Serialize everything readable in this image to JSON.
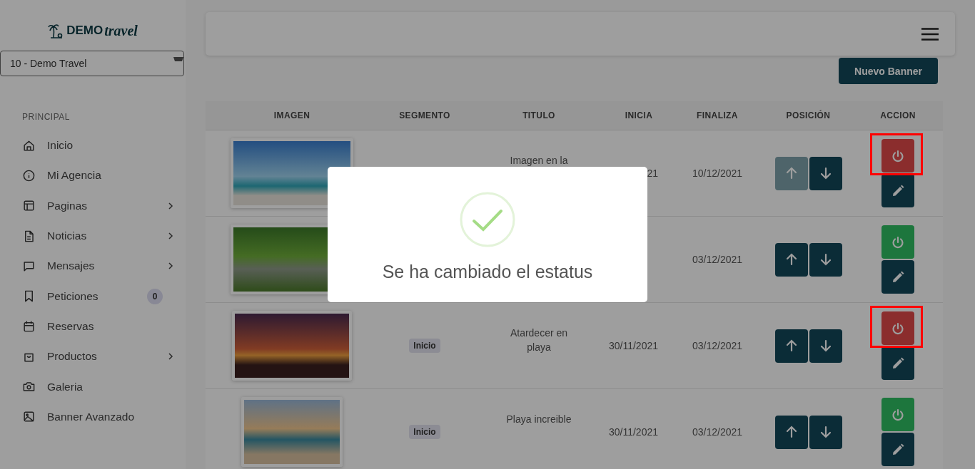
{
  "logo": {
    "word_a": "DEMO",
    "word_b": "travel"
  },
  "agency_select": {
    "value": "10 - Demo Travel"
  },
  "sidebar": {
    "section": "PRINCIPAL",
    "items": [
      {
        "label": "Inicio",
        "submenu": false
      },
      {
        "label": "Mi Agencia",
        "submenu": false
      },
      {
        "label": "Paginas",
        "submenu": true
      },
      {
        "label": "Noticias",
        "submenu": true
      },
      {
        "label": "Mensajes",
        "submenu": true
      },
      {
        "label": "Peticiones",
        "submenu": false,
        "badge": "0"
      },
      {
        "label": "Reservas",
        "submenu": false
      },
      {
        "label": "Productos",
        "submenu": true
      },
      {
        "label": "Galeria",
        "submenu": false
      },
      {
        "label": "Banner Avanzado",
        "submenu": false
      }
    ]
  },
  "new_banner_button": "Nuevo Banner",
  "table": {
    "columns": [
      "IMAGEN",
      "SEGMENTO",
      "TITULO",
      "INICIA",
      "FINALIZA",
      "POSICIÓN",
      "ACCION"
    ],
    "rows": [
      {
        "title": "Imagen en la",
        "start": "21",
        "end": "10/12/2021",
        "up_disabled": true,
        "active": false,
        "highlighted": true
      },
      {
        "end": "03/12/2021",
        "up_disabled": false,
        "active": true,
        "highlighted": false
      },
      {
        "segment": "Inicio",
        "title": "Atardecer en playa",
        "start": "30/11/2021",
        "end": "03/12/2021",
        "up_disabled": false,
        "active": false,
        "highlighted": true
      },
      {
        "segment": "Inicio",
        "title": "Playa increible",
        "start": "30/11/2021",
        "end": "03/12/2021",
        "up_disabled": false,
        "active": true,
        "highlighted": false
      }
    ]
  },
  "modal": {
    "message": "Se ha cambiado el estatus"
  }
}
